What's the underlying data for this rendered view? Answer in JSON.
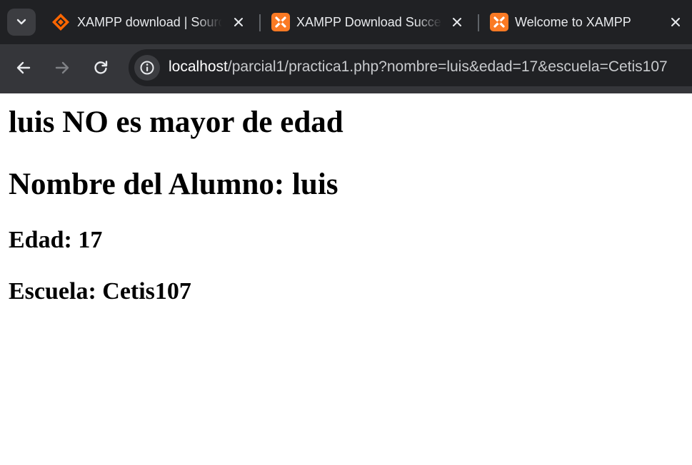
{
  "browser": {
    "tabs": [
      {
        "title": "XAMPP download | SourceForge.net",
        "favicon": "sourceforge-icon",
        "favicon_color": "#ff6600"
      },
      {
        "title": "XAMPP Download Success",
        "favicon": "xampp-icon",
        "favicon_color": "#fb7a24"
      },
      {
        "title": "Welcome to XAMPP",
        "favicon": "xampp-icon",
        "favicon_color": "#fb7a24",
        "active": true
      }
    ],
    "url": {
      "host": "localhost",
      "path": "/parcial1/practica1.php?nombre=luis&edad=17&escuela=Cetis107"
    }
  },
  "page": {
    "heading_status": "luis NO es mayor de edad",
    "heading_name": "Nombre del Alumno: luis",
    "edad": "Edad: 17",
    "escuela": "Escuela: Cetis107"
  },
  "colors": {
    "tabstrip_bg": "#202124",
    "toolbar_bg": "#35363a",
    "text_light": "#e8eaed",
    "page_bg": "#ffffff"
  }
}
